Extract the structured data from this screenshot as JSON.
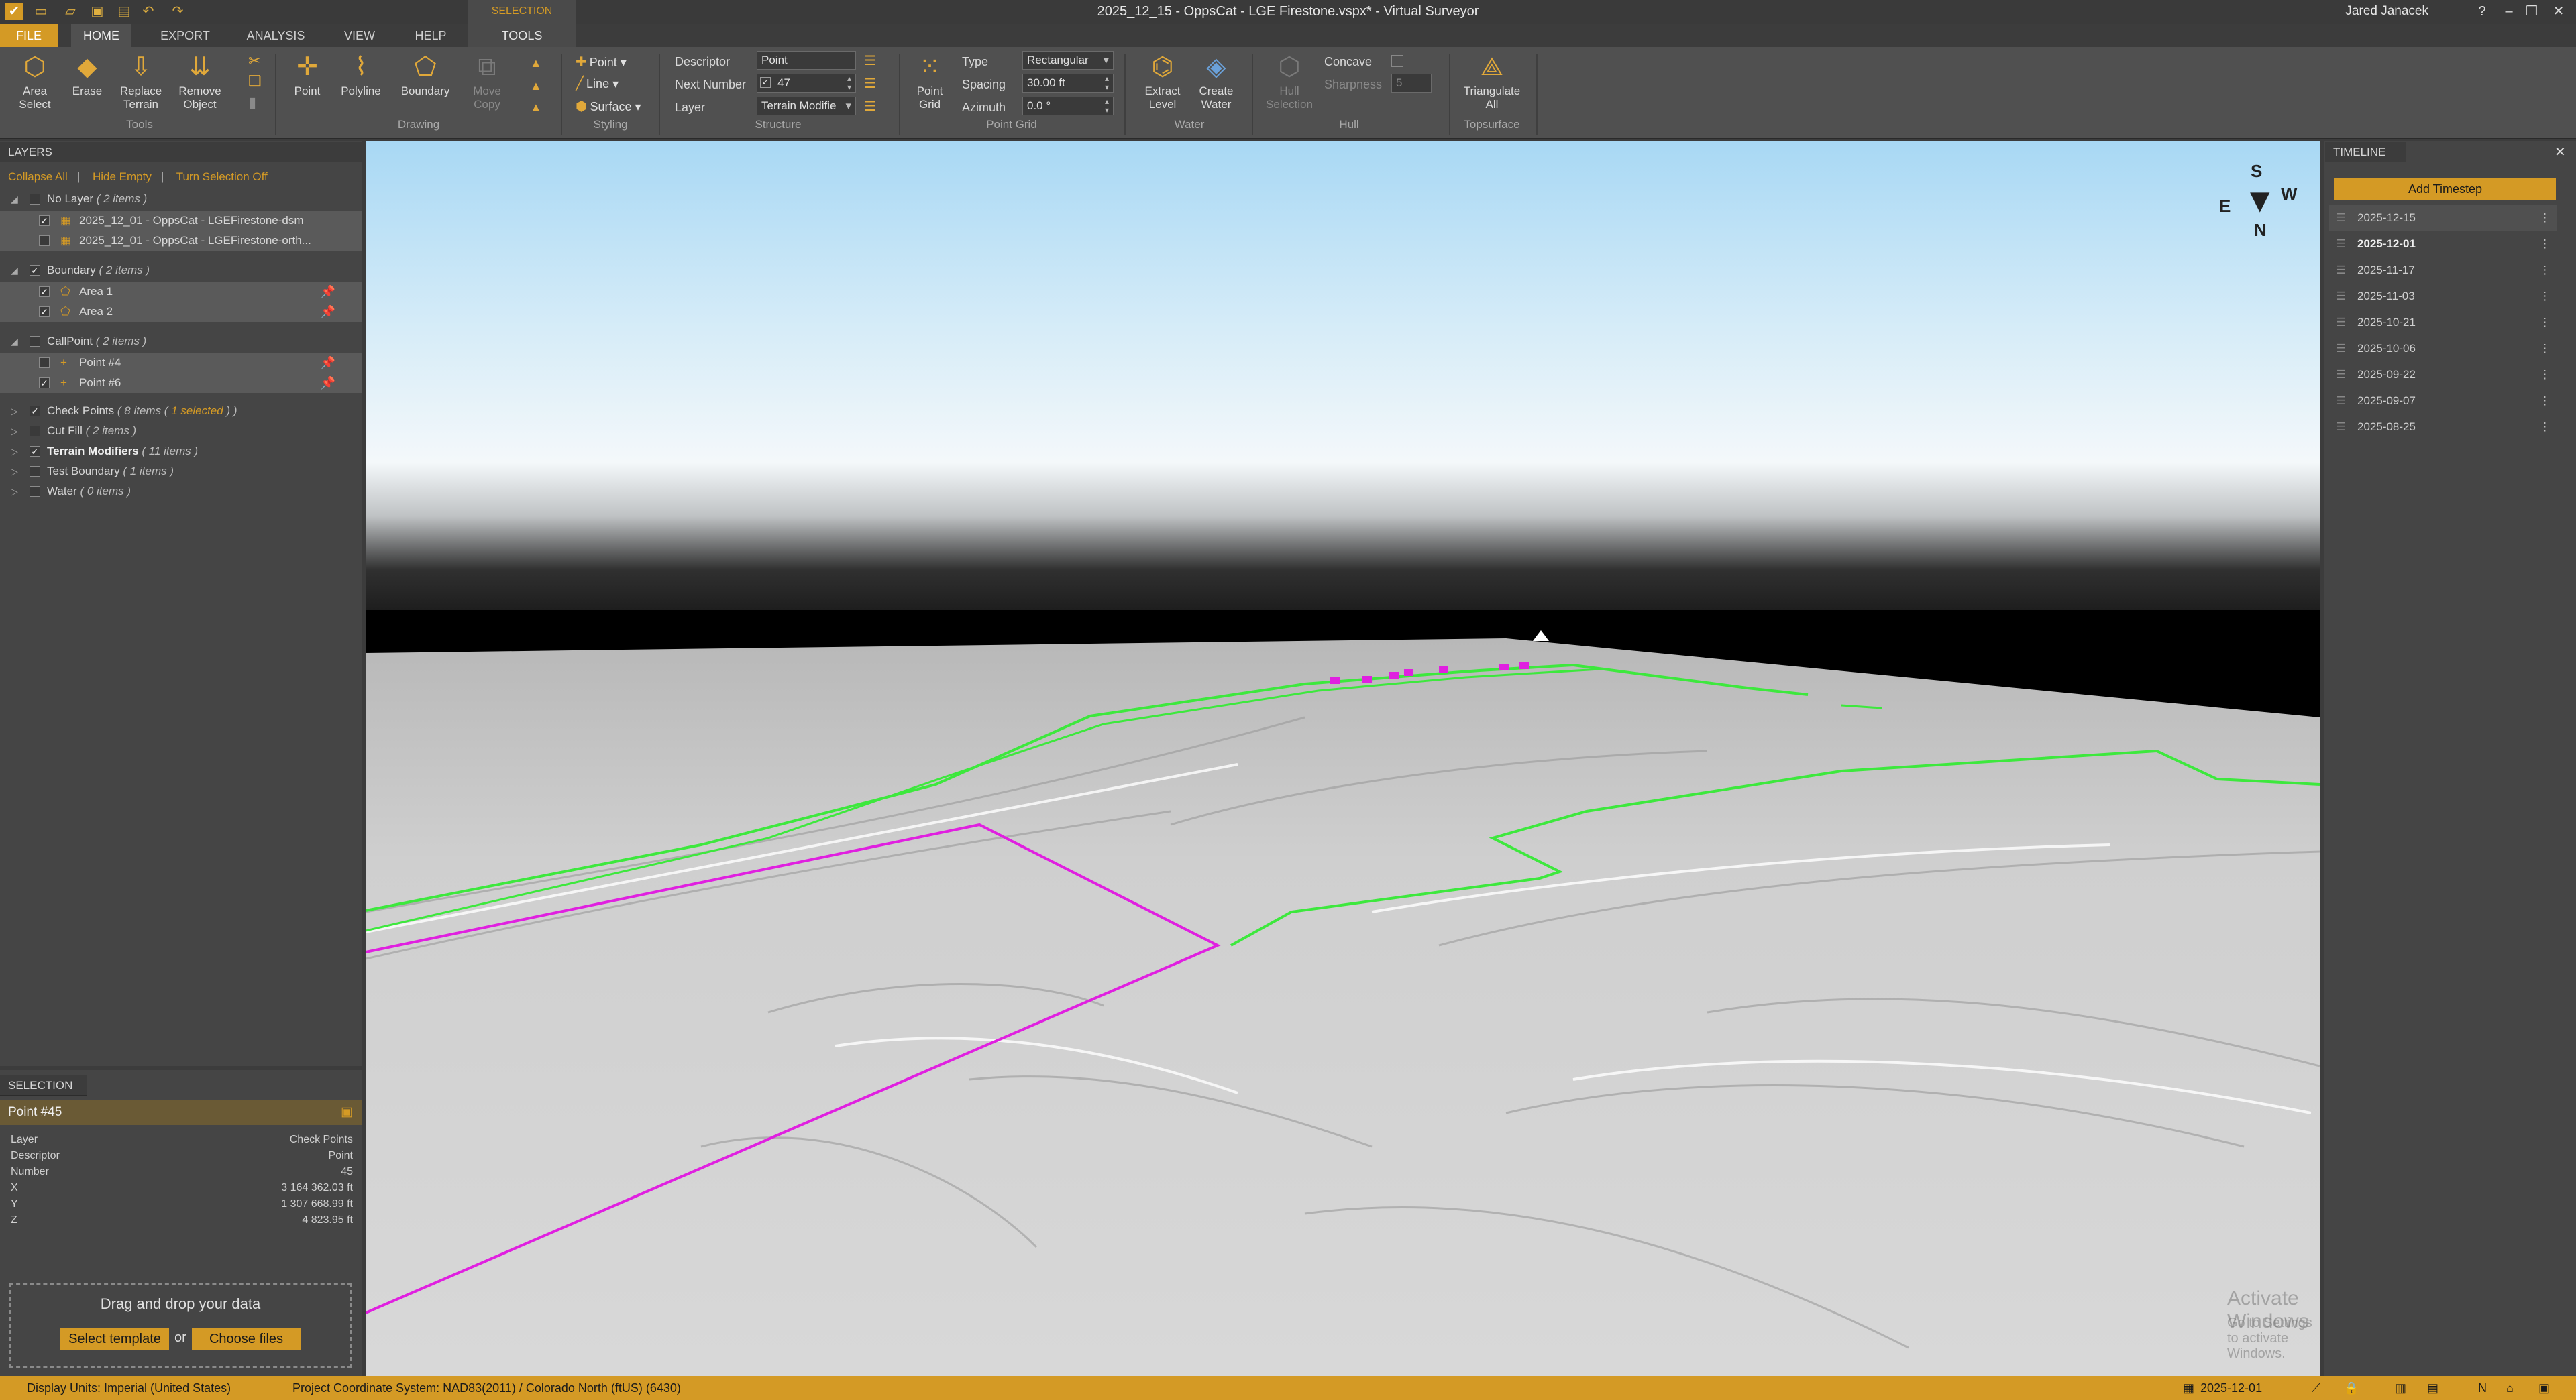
{
  "window": {
    "title": "2025_12_15 - OppsCat - LGE Firestone.vspx* - Virtual Surveyor",
    "user": "Jared Janacek",
    "context_tab_group": "SELECTION"
  },
  "tabs": {
    "file": "FILE",
    "home": "HOME",
    "export": "EXPORT",
    "analysis": "ANALYSIS",
    "view": "VIEW",
    "help": "HELP",
    "tools": "TOOLS"
  },
  "ribbon": {
    "tools": {
      "area_select": "Area\nSelect",
      "erase": "Erase",
      "replace_terrain": "Replace\nTerrain",
      "remove_object": "Remove\nObject",
      "group": "Tools"
    },
    "drawing": {
      "point": "Point",
      "polyline": "Polyline",
      "boundary": "Boundary",
      "move_copy": "Move\nCopy",
      "group": "Drawing"
    },
    "styling": {
      "point": "Point",
      "line": "Line",
      "surface": "Surface",
      "group": "Styling"
    },
    "structure": {
      "descriptor_label": "Descriptor",
      "descriptor_value": "Point",
      "next_number_label": "Next Number",
      "next_number_value": "47",
      "layer_label": "Layer",
      "layer_value": "Terrain Modifie",
      "group": "Structure"
    },
    "point_grid": {
      "button": "Point\nGrid",
      "type_label": "Type",
      "type_value": "Rectangular",
      "spacing_label": "Spacing",
      "spacing_value": "30.00 ft",
      "azimuth_label": "Azimuth",
      "azimuth_value": "0.0 °",
      "group": "Point Grid"
    },
    "water": {
      "extract_level": "Extract\nLevel",
      "create_water": "Create\nWater",
      "group": "Water"
    },
    "hull": {
      "hull_selection": "Hull\nSelection",
      "concave_label": "Concave",
      "sharpness_label": "Sharpness",
      "sharpness_value": "5",
      "group": "Hull"
    },
    "topsurface": {
      "triangulate_all": "Triangulate\nAll",
      "group": "Topsurface"
    }
  },
  "layers": {
    "header": "LAYERS",
    "collapse_all": "Collapse All",
    "hide_empty": "Hide Empty",
    "turn_selection_off": "Turn Selection Off",
    "groups": [
      {
        "name": "No Layer",
        "count": "( 2 items )",
        "checked": false,
        "expanded": true,
        "items": [
          {
            "name": "2025_12_01 - OppsCat - LGEFirestone-dsm",
            "checked": true
          },
          {
            "name": "2025_12_01 - OppsCat - LGEFirestone-orth...",
            "checked": false
          }
        ]
      },
      {
        "name": "Boundary",
        "count": "( 2 items )",
        "checked": true,
        "expanded": true,
        "items": [
          {
            "name": "Area 1",
            "checked": true
          },
          {
            "name": "Area 2",
            "checked": true
          }
        ]
      },
      {
        "name": "CallPoint",
        "count": "( 2 items )",
        "checked": false,
        "expanded": true,
        "items": [
          {
            "name": "Point #4",
            "checked": false
          },
          {
            "name": "Point #6",
            "checked": true
          }
        ]
      },
      {
        "name": "Check Points",
        "count": "( 8 items (",
        "extra": "1 selected",
        "extra_end": ") )",
        "checked": true,
        "expanded": false
      },
      {
        "name": "Cut Fill",
        "count": "( 2 items )",
        "checked": false,
        "expanded": false
      },
      {
        "name": "Terrain Modifiers",
        "count": "( 11 items )",
        "checked": true,
        "expanded": false,
        "bold": true
      },
      {
        "name": "Test Boundary",
        "count": "( 1 items )",
        "checked": false,
        "expanded": false
      },
      {
        "name": "Water",
        "count": "( 0 items )",
        "checked": false,
        "expanded": false
      }
    ]
  },
  "selection": {
    "header": "SELECTION",
    "title": "Point #45",
    "fields": [
      {
        "k": "Layer",
        "v": "Check Points"
      },
      {
        "k": "Descriptor",
        "v": "Point"
      },
      {
        "k": "Number",
        "v": "45"
      },
      {
        "k": "X",
        "v": "3 164 362.03 ft"
      },
      {
        "k": "Y",
        "v": "1 307 668.99 ft"
      },
      {
        "k": "Z",
        "v": "4 823.95 ft"
      }
    ],
    "drop_text": "Drag and drop your data",
    "select_template": "Select template",
    "or": "or",
    "choose_files": "Choose files"
  },
  "timeline": {
    "header": "TIMELINE",
    "add_timestep": "Add Timestep",
    "steps": [
      "2025-12-15",
      "2025-12-01",
      "2025-11-17",
      "2025-11-03",
      "2025-10-21",
      "2025-10-06",
      "2025-09-22",
      "2025-09-07",
      "2025-08-25"
    ],
    "active_index": 0,
    "bold_index": 1
  },
  "compass": {
    "n": "N",
    "s": "S",
    "e": "E",
    "w": "W"
  },
  "watermark": {
    "line1": "Activate Windows",
    "line2": "Go to Settings to activate Windows."
  },
  "status": {
    "display_units": "Display Units:  Imperial (United States)",
    "crs": "Project Coordinate System:  NAD83(2011) / Colorado North (ftUS) (6430)",
    "date": "2025-12-01"
  },
  "colors": {
    "accent": "#d49a25",
    "boundary_green": "#3de83d",
    "boundary_magenta": "#e020e0"
  }
}
